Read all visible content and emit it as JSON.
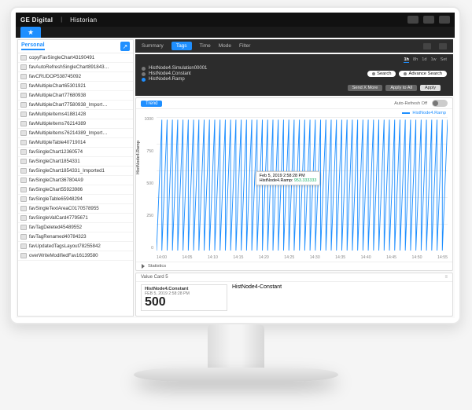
{
  "brand": {
    "company": "GE Digital",
    "product": "Historian"
  },
  "sidebar": {
    "tab_label": "Personal",
    "items": [
      "copyFavSingleChart43190491",
      "favAutoRefreshSingleChart891843…",
      "favCRUDOP538745092",
      "favMultipleChart65301921",
      "favMultipleChart77680938",
      "favMultipleChart77580938_Import…",
      "favMultipleItems41881428",
      "favMultipleItems76214389",
      "favMultipleItems76214389_Import…",
      "favMultipleTable40719014",
      "favSingleChart12360574",
      "favSingleChart1854331",
      "favSingleChart1854331_Imported1",
      "favSingleChart367804A9",
      "favSingleChart55923986",
      "favSingleTable65948294",
      "favSingleTextAreaC0170578955",
      "favSingleValCard47795671",
      "favTagDeleted45489552",
      "favTagRenamed40784323",
      "favUpdatedTagsLayout78255842",
      "overWriteModifiedFav16139580"
    ]
  },
  "tabs": {
    "items": [
      "Summary",
      "Tags",
      "Time",
      "Mode",
      "Filter"
    ],
    "active_index": 1
  },
  "time_ranges": {
    "items": [
      "1h",
      "8h",
      "1d",
      "1w",
      "Set"
    ],
    "active_index": 0
  },
  "tag_panel": {
    "tags": [
      {
        "name": "HistNode4.Simulation00001",
        "active": false
      },
      {
        "name": "HistNode4.Constant",
        "active": false
      },
      {
        "name": "HistNode4.Ramp",
        "active": true
      }
    ],
    "search_label": "Search",
    "adv_search_label": "Advance Search",
    "actions": {
      "send": "Send X More",
      "apply_all": "Apply to All",
      "apply": "Apply"
    }
  },
  "chart_card": {
    "title": "Trend",
    "auto_refresh_label": "Auto-Refresh Off",
    "legend": "HistNode4.Ramp",
    "statistics_label": "Statistics",
    "tooltip_time": "Feb 5, 2019 2:58:28 PM",
    "tooltip_series": "HistNode4.Ramp",
    "tooltip_value": "953.333333"
  },
  "chart_data": {
    "type": "line",
    "title": "Trend",
    "xlabel": "",
    "ylabel": "HistNode4.Ramp",
    "ylim": [
      0,
      1000
    ],
    "y_ticks": [
      1000,
      750,
      500,
      250,
      0
    ],
    "x_ticks": [
      "14:00",
      "14:05",
      "14:10",
      "14:15",
      "14:20",
      "14:25",
      "14:30",
      "14:35",
      "14:40",
      "14:45",
      "14:50",
      "14:55"
    ],
    "series": [
      {
        "name": "HistNode4.Ramp",
        "color": "#1f8fff",
        "note": "sawtooth ramp ~0→1000 repeating roughly every minute across the hour",
        "sample_point": {
          "x": "14:18:28",
          "y": 953.33
        }
      }
    ]
  },
  "value_card": {
    "title": "Value  Card  5",
    "tag": "HistNode4.Constant",
    "timestamp": "FEB 5, 2019 2:58:28 PM",
    "value": "500",
    "caption": "HistNode4-Constant"
  }
}
